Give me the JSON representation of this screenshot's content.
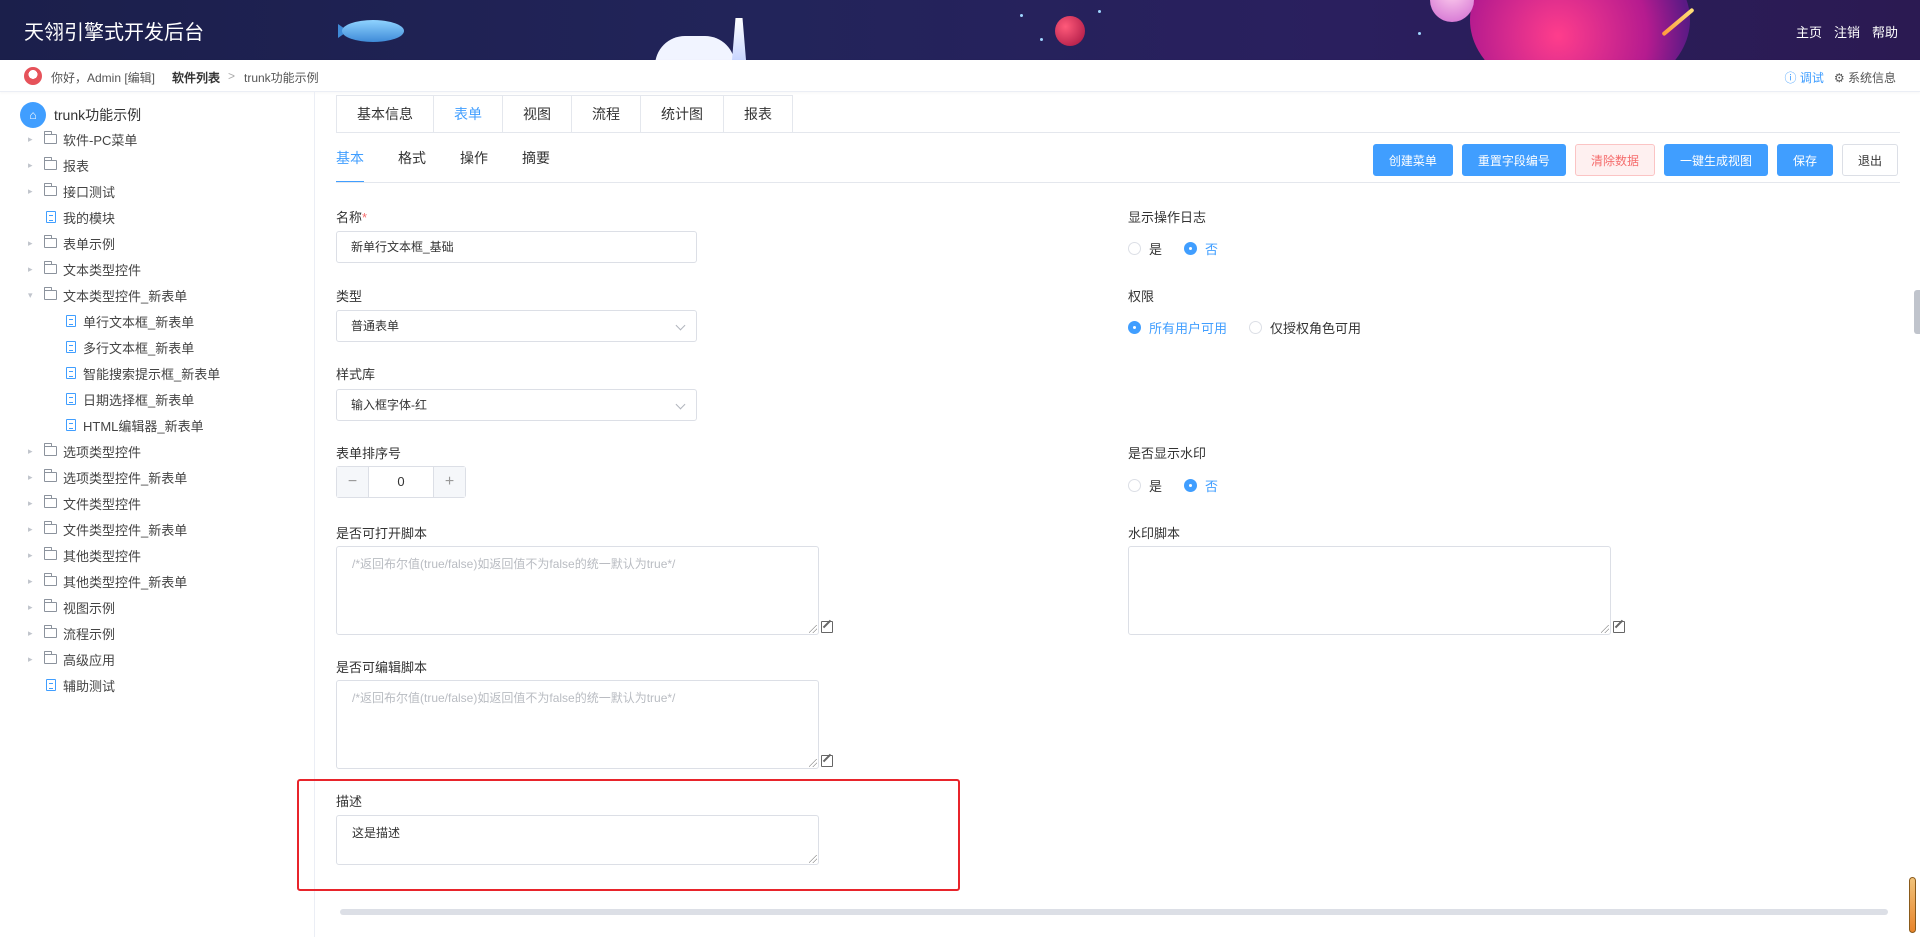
{
  "header": {
    "title": "天翎引擎式开发后台",
    "links": [
      "主页",
      "注销",
      "帮助"
    ]
  },
  "crumbbar": {
    "greeting": "你好，Admin [编辑]",
    "crumbs": [
      "软件列表",
      "trunk功能示例"
    ],
    "separator": ">",
    "debug": "调试",
    "sysinfo": "系统信息"
  },
  "sidebar": {
    "root": "trunk功能示例",
    "items": [
      {
        "label": "软件-PC菜单",
        "type": "folder",
        "expandable": true
      },
      {
        "label": "报表",
        "type": "folder",
        "expandable": true
      },
      {
        "label": "接口测试",
        "type": "folder",
        "expandable": true
      },
      {
        "label": "我的模块",
        "type": "doc",
        "expandable": false
      },
      {
        "label": "表单示例",
        "type": "folder",
        "expandable": true
      },
      {
        "label": "文本类型控件",
        "type": "folder",
        "expandable": true
      },
      {
        "label": "文本类型控件_新表单",
        "type": "folder",
        "expandable": true,
        "expanded": true
      },
      {
        "label": "单行文本框_新表单",
        "type": "doc",
        "child": true
      },
      {
        "label": "多行文本框_新表单",
        "type": "doc",
        "child": true
      },
      {
        "label": "智能搜索提示框_新表单",
        "type": "doc",
        "child": true
      },
      {
        "label": "日期选择框_新表单",
        "type": "doc",
        "child": true
      },
      {
        "label": "HTML编辑器_新表单",
        "type": "doc",
        "child": true
      },
      {
        "label": "选项类型控件",
        "type": "folder",
        "expandable": true
      },
      {
        "label": "选项类型控件_新表单",
        "type": "folder",
        "expandable": true
      },
      {
        "label": "文件类型控件",
        "type": "folder",
        "expandable": true
      },
      {
        "label": "文件类型控件_新表单",
        "type": "folder",
        "expandable": true
      },
      {
        "label": "其他类型控件",
        "type": "folder",
        "expandable": true
      },
      {
        "label": "其他类型控件_新表单",
        "type": "folder",
        "expandable": true
      },
      {
        "label": "视图示例",
        "type": "folder",
        "expandable": true
      },
      {
        "label": "流程示例",
        "type": "folder",
        "expandable": true
      },
      {
        "label": "高级应用",
        "type": "folder",
        "expandable": true
      },
      {
        "label": "辅助测试",
        "type": "doc",
        "expandable": false
      }
    ]
  },
  "tabs": [
    "基本信息",
    "表单",
    "视图",
    "流程",
    "统计图",
    "报表"
  ],
  "active_tab": "表单",
  "subtabs": [
    "基本",
    "格式",
    "操作",
    "摘要"
  ],
  "active_subtab": "基本",
  "toolbar": {
    "create_menu": "创建菜单",
    "reset_field_ids": "重置字段编号",
    "clear_data": "清除数据",
    "generate_view": "一键生成视图",
    "save": "保存",
    "exit": "退出"
  },
  "form": {
    "name_label": "名称",
    "name_required_mark": "*",
    "name_value": "新单行文本框_基础",
    "type_label": "类型",
    "type_value": "普通表单",
    "style_label": "样式库",
    "style_value": "输入框字体-红",
    "order_label": "表单排序号",
    "order_value": "0",
    "step_minus": "−",
    "step_plus": "+",
    "openscript_label": "是否可打开脚本",
    "openscript_placeholder": "/*返回布尔值(true/false)如返回值不为false的统一默认为true*/",
    "editscript_label": "是否可编辑脚本",
    "editscript_placeholder": "/*返回布尔值(true/false)如返回值不为false的统一默认为true*/",
    "desc_label": "描述",
    "desc_value": "这是描述",
    "log_label": "显示操作日志",
    "log_options": [
      "是",
      "否"
    ],
    "log_selected": "否",
    "perm_label": "权限",
    "perm_options": [
      "所有用户可用",
      "仅授权角色可用"
    ],
    "perm_selected": "所有用户可用",
    "watermark_label": "是否显示水印",
    "watermark_options": [
      "是",
      "否"
    ],
    "watermark_selected": "否",
    "watermark_script_label": "水印脚本"
  },
  "colors": {
    "primary": "#409eff",
    "danger": "#f56c6c",
    "highlight": "#e8242b",
    "header_bg": "#1b1f4b"
  }
}
